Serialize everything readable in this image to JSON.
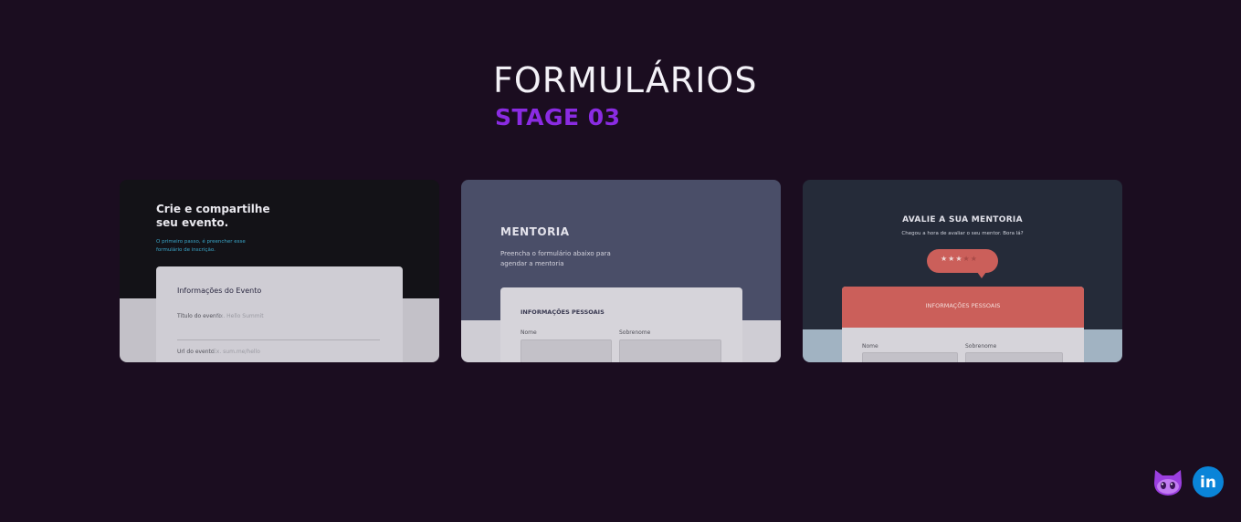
{
  "header": {
    "title": "FORMULÁRIOS",
    "subtitle": "STAGE 03"
  },
  "colors": {
    "background": "#1b0d20",
    "accent": "#8a2be2",
    "rating": "#cb5f5a",
    "linkedin": "#0a84d8"
  },
  "cards": [
    {
      "heading": "Crie e compartilhe seu evento.",
      "intro": "O primeiro passo, é preencher esse formulário de inscrição.",
      "form_title": "Informações do Evento",
      "fields": [
        {
          "label": "Título do evento",
          "placeholder": "Ex. Hello Summit"
        },
        {
          "label": "Url do evento",
          "placeholder": "Ex. sum.me/hello"
        }
      ]
    },
    {
      "heading": "MENTORIA",
      "intro": "Preencha o formulário abaixo para agendar a mentoria",
      "form_title": "INFORMAÇÕES PESSOAIS",
      "fields": [
        {
          "label": "Nome"
        },
        {
          "label": "Sobrenome"
        }
      ]
    },
    {
      "heading": "AVALIE A SUA MENTORIA",
      "intro": "Chegou a hora de avaliar o seu mentor. Bora lá?",
      "rating": {
        "value": 3,
        "max": 5,
        "icon": "star-icon"
      },
      "form_title": "INFORMAÇÕES PESSOAIS",
      "fields": [
        {
          "label": "Nome"
        },
        {
          "label": "Sobrenome"
        }
      ]
    }
  ],
  "social": [
    {
      "name": "github",
      "icon": "github-cat-icon"
    },
    {
      "name": "linkedin",
      "icon": "linkedin-icon",
      "text": "in"
    }
  ]
}
